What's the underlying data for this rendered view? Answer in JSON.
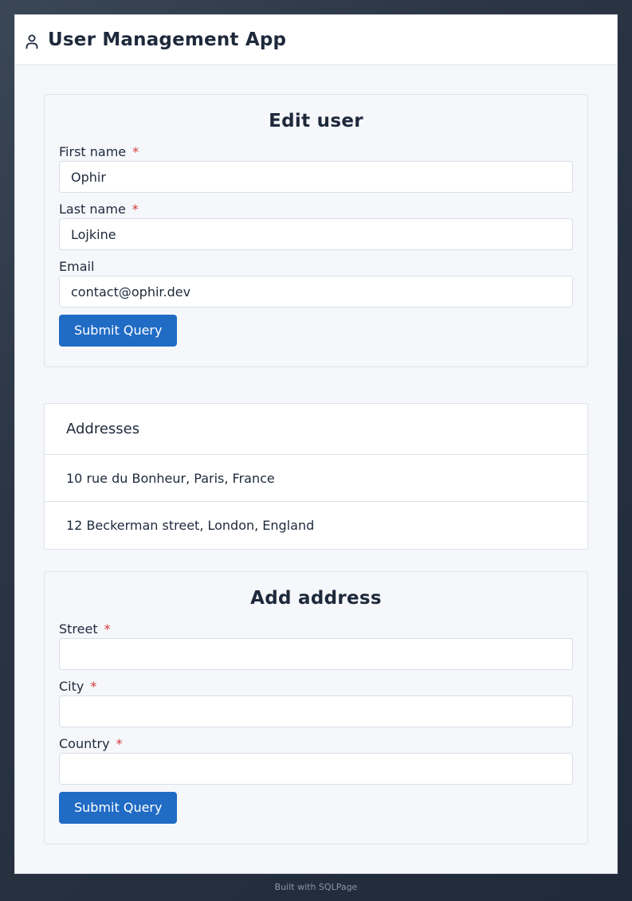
{
  "header": {
    "title": "User Management App",
    "icon": "user-icon"
  },
  "edit_user": {
    "title": "Edit user",
    "first_name": {
      "label": "First name",
      "required_mark": "*",
      "value": "Ophir"
    },
    "last_name": {
      "label": "Last name",
      "required_mark": "*",
      "value": "Lojkine"
    },
    "email": {
      "label": "Email",
      "value": "contact@ophir.dev"
    },
    "submit_label": "Submit Query"
  },
  "addresses": {
    "title": "Addresses",
    "items": [
      "10 rue du Bonheur, Paris, France",
      "12 Beckerman street, London, England"
    ]
  },
  "add_address": {
    "title": "Add address",
    "street": {
      "label": "Street",
      "required_mark": "*",
      "value": ""
    },
    "city": {
      "label": "City",
      "required_mark": "*",
      "value": ""
    },
    "country": {
      "label": "Country",
      "required_mark": "*",
      "value": ""
    },
    "submit_label": "Submit Query"
  },
  "footer": {
    "text": "Built with SQLPage"
  },
  "colors": {
    "primary": "#206bc4",
    "required": "#d63939",
    "text": "#1e293b"
  }
}
